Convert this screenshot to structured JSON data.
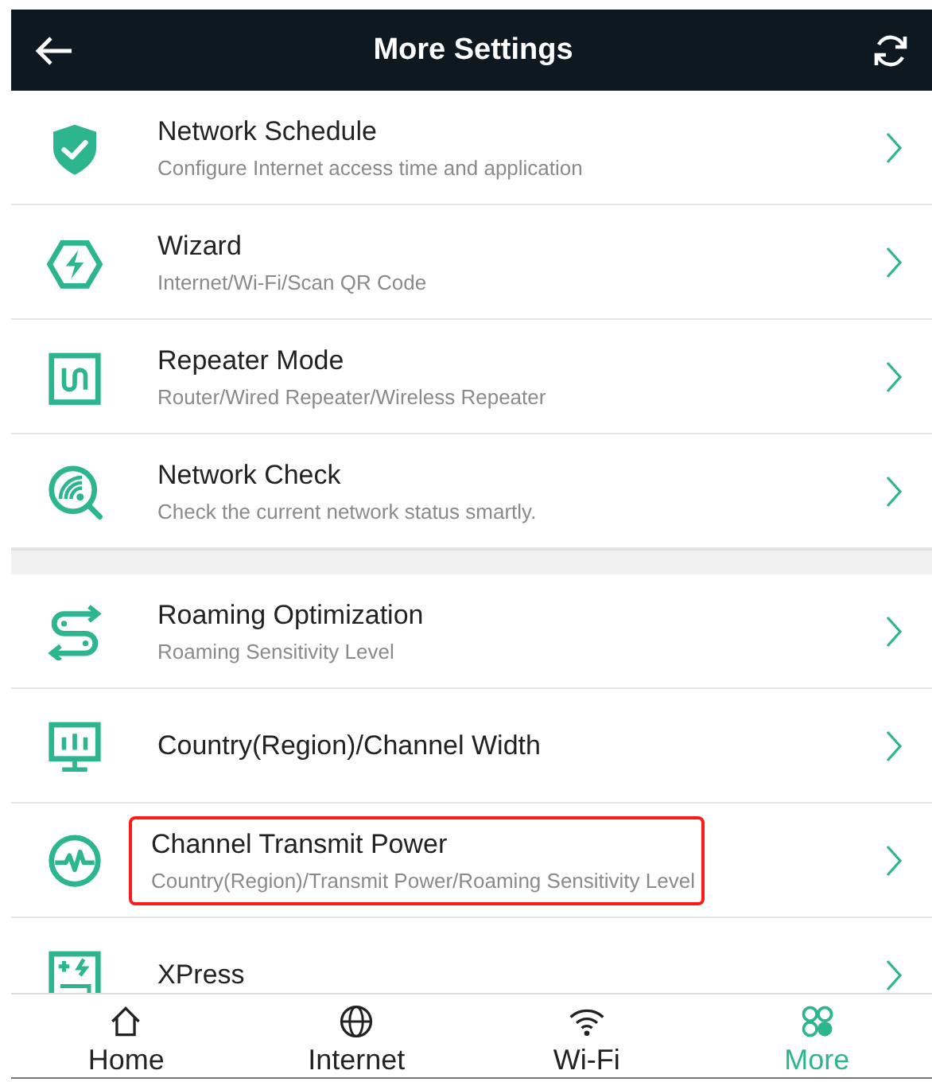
{
  "header": {
    "title": "More Settings"
  },
  "sections": [
    {
      "items": [
        {
          "title": "Network Schedule",
          "subtitle": "Configure Internet access time and application",
          "highlighted": false
        },
        {
          "title": "Wizard",
          "subtitle": "Internet/Wi-Fi/Scan QR Code",
          "highlighted": false
        },
        {
          "title": "Repeater Mode",
          "subtitle": "Router/Wired Repeater/Wireless Repeater",
          "highlighted": false
        },
        {
          "title": "Network Check",
          "subtitle": "Check the current network status smartly.",
          "highlighted": false
        }
      ]
    },
    {
      "items": [
        {
          "title": "Roaming Optimization",
          "subtitle": "Roaming Sensitivity Level",
          "highlighted": false
        },
        {
          "title": "Country(Region)/Channel Width",
          "highlighted": false
        },
        {
          "title": "Channel Transmit Power",
          "subtitle": "Country(Region)/Transmit Power/Roaming Sensitivity Level",
          "highlighted": true
        },
        {
          "title": "XPress",
          "highlighted": false
        }
      ]
    }
  ],
  "tabs": [
    {
      "label": "Home",
      "selected": false
    },
    {
      "label": "Internet",
      "selected": false
    },
    {
      "label": "Wi-Fi",
      "selected": false
    },
    {
      "label": "More",
      "selected": true
    }
  ]
}
